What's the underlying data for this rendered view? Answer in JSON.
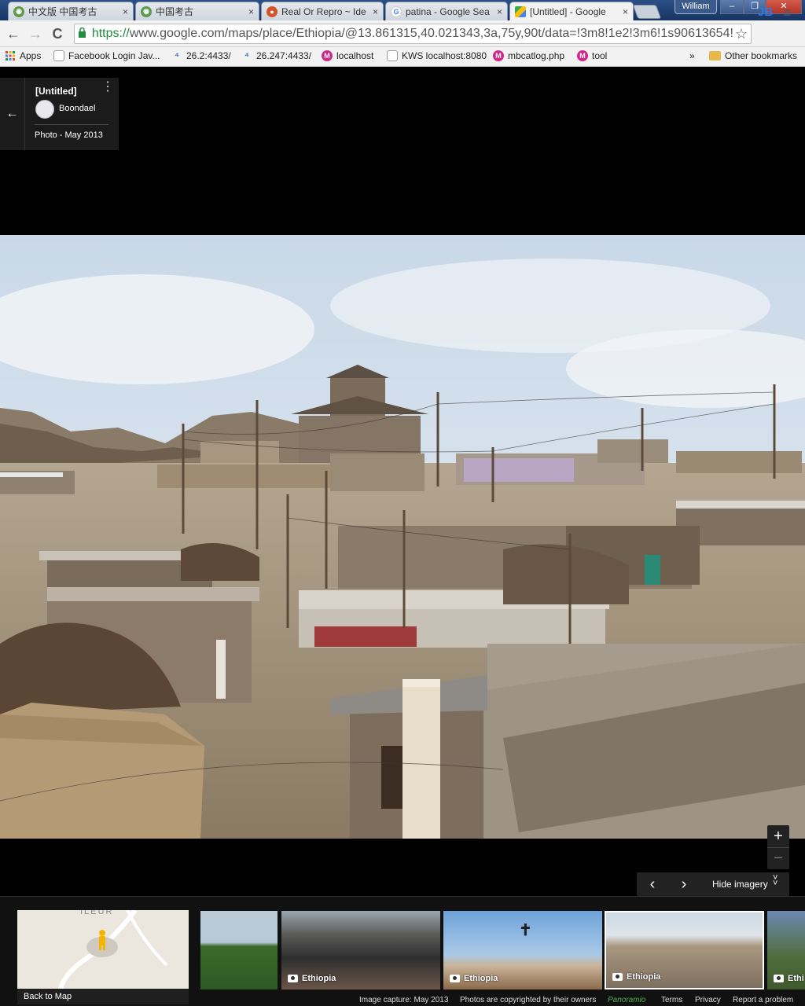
{
  "tabs": [
    {
      "label": "中文版 中国考古",
      "icon": "china-archaeology-icon",
      "close": "×"
    },
    {
      "label": "中国考古",
      "icon": "china-archaeology-icon",
      "close": "×"
    },
    {
      "label": "Real Or Repro ~ Ide",
      "icon": "real-or-repro-icon",
      "close": "×"
    },
    {
      "label": "patina - Google Sea",
      "icon": "google-icon",
      "close": "×"
    },
    {
      "label": "[Untitled] - Google",
      "icon": "google-maps-icon",
      "close": "×",
      "active": true
    }
  ],
  "window": {
    "user": "William",
    "minimize": "–",
    "maximize": "❐",
    "close": "✕"
  },
  "toolbar": {
    "back": "←",
    "forward": "→",
    "reload": "C",
    "url_scheme": "https://",
    "url_rest": "www.google.com/maps/place/Ethiopia/@13.861315,40.021343,3a,75y,90t/data=!3m8!1e2!3m6!1s90613654!",
    "star": "☆",
    "ext": "JB",
    "menu": "≡"
  },
  "bookmarks": {
    "apps": "Apps",
    "items": [
      "Facebook Login Jav...",
      "26.2:4433/",
      "26.247:4433/",
      "localhost",
      "KWS localhost:8080",
      "mbcatlog.php",
      "tool"
    ],
    "more": "»",
    "other": "Other bookmarks"
  },
  "card": {
    "title": "[Untitled]",
    "more": "⋮",
    "author": "Boondael",
    "date": "Photo - May 2013",
    "back": "←"
  },
  "controls": {
    "zoom_in": "+",
    "zoom_out": "−",
    "prev": "‹",
    "next": "›",
    "hide_imagery": "Hide imagery",
    "hide_chevron": "˅"
  },
  "filmstrip": {
    "back_to_map": "Back to Map",
    "map_text": "ILEUR",
    "thumbs": [
      {
        "label": ""
      },
      {
        "label": "Ethiopia"
      },
      {
        "label": "Ethiopia"
      },
      {
        "label": "Ethiopia"
      },
      {
        "label": "Ethi"
      }
    ]
  },
  "footer": {
    "capture": "Image capture: May 2013",
    "copyright": "Photos are copyrighted by their owners",
    "brand": "Panoramio",
    "terms": "Terms",
    "privacy": "Privacy",
    "report": "Report a problem"
  },
  "colors": {
    "secure_green": "#1e8e3e",
    "tab_bar": "#1f3e6e",
    "viewer_bg": "#000000"
  }
}
